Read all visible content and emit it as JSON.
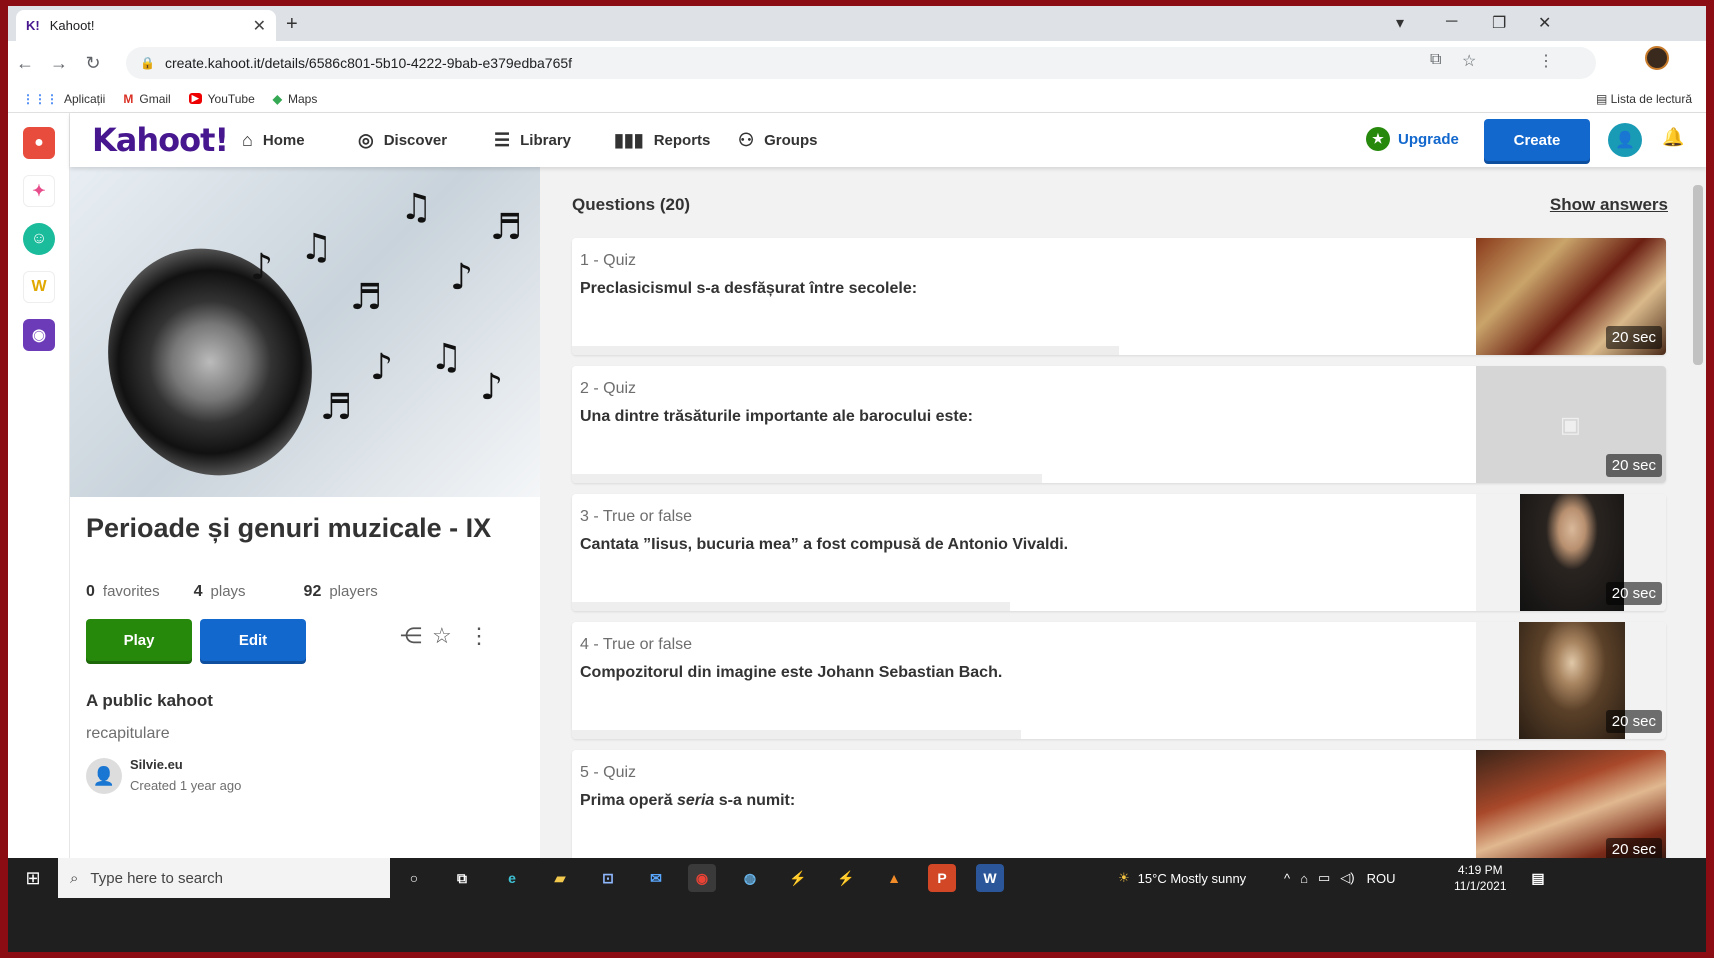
{
  "browser": {
    "tab_title": "Kahoot!",
    "tab_favicon": "K!",
    "url": "create.kahoot.it/details/6586c801-5b10-4222-9bab-e379edba765f",
    "bookmarks": [
      {
        "label": "Aplicații",
        "icon": "apps-grid-icon"
      },
      {
        "label": "Gmail",
        "icon": "gmail-icon"
      },
      {
        "label": "YouTube",
        "icon": "youtube-icon"
      },
      {
        "label": "Maps",
        "icon": "maps-icon"
      }
    ],
    "reading_list": "Lista de lectură"
  },
  "nav": {
    "logo": "Kahoot!",
    "items": [
      {
        "label": "Home",
        "icon": "home-icon"
      },
      {
        "label": "Discover",
        "icon": "compass-icon"
      },
      {
        "label": "Library",
        "icon": "list-icon"
      },
      {
        "label": "Reports",
        "icon": "bar-chart-icon"
      },
      {
        "label": "Groups",
        "icon": "groups-icon"
      }
    ],
    "upgrade": "Upgrade",
    "create": "Create"
  },
  "kahoot": {
    "title": "Perioade și genuri muzicale - IX",
    "favorites_count": "0",
    "favorites_label": "favorites",
    "plays_count": "4",
    "plays_label": "plays",
    "players_count": "92",
    "players_label": "players",
    "play_button": "Play",
    "edit_button": "Edit",
    "visibility": "A public kahoot",
    "description": "recapitulare",
    "creator": "Silvie.eu",
    "created": "Created 1 year ago"
  },
  "questions": {
    "header": "Questions (20)",
    "show_answers": "Show answers",
    "items": [
      {
        "type": "1 - Quiz",
        "text": "Preclasicismul s-a desfășurat între secolele:",
        "time": "20 sec",
        "progress": 0.5
      },
      {
        "type": "2 - Quiz",
        "text": "Una dintre trăsăturile importante ale barocului este:",
        "time": "20 sec",
        "progress": 0.43
      },
      {
        "type": "3 - True or false",
        "text": "Cantata ”Iisus, bucuria mea” a fost compusă de Antonio Vivaldi.",
        "time": "20 sec",
        "progress": 0.4
      },
      {
        "type": "4 - True or false",
        "text": "Compozitorul din imagine este Johann Sebastian Bach.",
        "time": "20 sec",
        "progress": 0.41
      },
      {
        "type": "5 - Quiz",
        "text_before": "Prima operă ",
        "text_em": "seria",
        "text_after": " s-a numit:",
        "time": "20 sec",
        "progress": 0.4
      }
    ]
  },
  "taskbar": {
    "search_placeholder": "Type here to search",
    "weather": "15°C  Mostly sunny",
    "language": "ROU",
    "time": "4:19 PM",
    "date": "11/1/2021"
  },
  "colors": {
    "kahoot_purple": "#46178f",
    "blue": "#1368ce",
    "green": "#26890c"
  }
}
